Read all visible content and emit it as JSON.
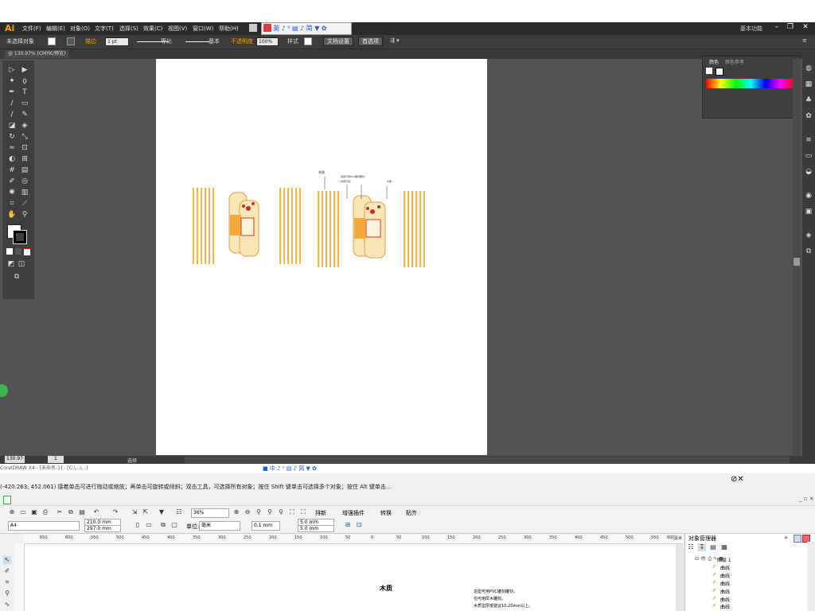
{
  "illustrator": {
    "logo": "Ai",
    "menu": [
      "文件(F)",
      "编辑(E)",
      "对象(O)",
      "文字(T)",
      "选择(S)",
      "效果(C)",
      "视图(V)",
      "窗口(W)",
      "帮助(H)"
    ],
    "workspace": "基本功能",
    "control_bar": {
      "selection_state": "未选择对象",
      "stroke_label": "描边",
      "stroke_weight": "1 pt",
      "stroke_profile": "等比",
      "brush": "基本",
      "opacity_label": "不透明度",
      "opacity_value": "100%",
      "style_label": "样式",
      "doc_setup": "文档设置",
      "preferences": "首选项"
    },
    "doc_tab": "@ 130.97% (CMYK/预览)",
    "color_panel": {
      "tab1": "颜色",
      "tab2": "颜色参考"
    },
    "artwork": {
      "label_wood": "木质",
      "note_lines": [
        "造型可用PVC雕刻雕刻...",
        "材质可选...",
        "木质..."
      ]
    },
    "status": {
      "zoom": "130.97",
      "page": "1",
      "tool": "选择"
    },
    "colors": {
      "accent": "#ff9a00",
      "stripe": "#f5b44a",
      "spectrum": "rainbow"
    }
  },
  "coreldraw": {
    "title": "CorelDRAW X4 - [未命名-1] - [C:\\...\\...]",
    "hint": "(-420.263, 452.061)  接着单击可进行拖动或缩放；再单击可旋转或倾斜；双击工具，可选择所有对象；按住 Shift 键单击可选择多个对象；按住 Alt 键单击...",
    "zoom": "36%",
    "toolbar": {
      "arrange": "排新",
      "plugin": "增强插件",
      "convert": "转换",
      "paste": "贴齐"
    },
    "page_size": "A4",
    "width": "210.0 mm",
    "height": "297.0 mm",
    "unit_label": "单位:",
    "unit": "毫米",
    "nudge": "0.1 mm",
    "dup_x": "5.0 mm",
    "dup_y": "5.0 mm",
    "ruler_ticks": [
      "650",
      "600",
      "550",
      "500",
      "450",
      "400",
      "350",
      "300",
      "250",
      "200",
      "150",
      "100",
      "50",
      "0",
      "50",
      "100",
      "150",
      "200",
      "250",
      "300",
      "350",
      "400",
      "450",
      "500",
      "550",
      "600"
    ],
    "ruler_unit": "毫米",
    "canvas_text": {
      "title": "木质",
      "lines": [
        "造型可用PVC雕刻雕刻，",
        "也可用厚木雕刻。",
        "木质型厚度建议10-20mm以上。"
      ]
    },
    "object_manager": {
      "title": "对象管理器",
      "page": "页面 1",
      "layer": "图层 1",
      "items": [
        "曲线",
        "曲线",
        "曲线",
        "曲线",
        "曲线",
        "曲线",
        "曲线"
      ]
    }
  }
}
